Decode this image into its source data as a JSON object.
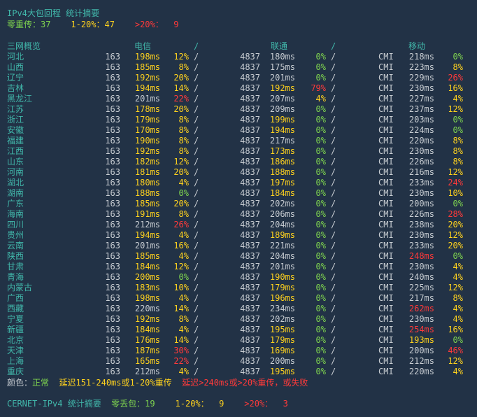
{
  "summary": {
    "title": "IPv4大包回程 统计摘要",
    "zero_label": "零重传：",
    "zero_value": "37",
    "mid_label": "1-20%：",
    "mid_value": "47",
    "high_label": ">20%：",
    "high_value": "9"
  },
  "table": {
    "header": {
      "region": "三网概览",
      "ct": "电信",
      "cu": "联通",
      "cm": "移动",
      "sep": "/"
    },
    "rows": [
      {
        "province": "河北",
        "ct_asn": "163",
        "ct_lat": "198ms",
        "ct_loss": "12%",
        "cu_asn": "4837",
        "cu_lat": "180ms",
        "cu_loss": "0%",
        "cm_asn": "CMI",
        "cm_lat": "218ms",
        "cm_loss": "0%",
        "c": [
          "yel",
          "yel",
          "gry",
          "grn",
          "gry",
          "grn"
        ]
      },
      {
        "province": "山西",
        "ct_asn": "163",
        "ct_lat": "185ms",
        "ct_loss": "8%",
        "cu_asn": "4837",
        "cu_lat": "175ms",
        "cu_loss": "0%",
        "cm_asn": "CMI",
        "cm_lat": "223ms",
        "cm_loss": "8%",
        "c": [
          "yel",
          "yel",
          "gry",
          "grn",
          "gry",
          "yel"
        ]
      },
      {
        "province": "辽宁",
        "ct_asn": "163",
        "ct_lat": "192ms",
        "ct_loss": "20%",
        "cu_asn": "4837",
        "cu_lat": "201ms",
        "cu_loss": "0%",
        "cm_asn": "CMI",
        "cm_lat": "229ms",
        "cm_loss": "26%",
        "c": [
          "yel",
          "yel",
          "gry",
          "grn",
          "gry",
          "red"
        ]
      },
      {
        "province": "吉林",
        "ct_asn": "163",
        "ct_lat": "194ms",
        "ct_loss": "14%",
        "cu_asn": "4837",
        "cu_lat": "192ms",
        "cu_loss": "79%",
        "cm_asn": "CMI",
        "cm_lat": "230ms",
        "cm_loss": "16%",
        "c": [
          "yel",
          "yel",
          "yel",
          "red",
          "gry",
          "yel"
        ]
      },
      {
        "province": "黑龙江",
        "ct_asn": "163",
        "ct_lat": "201ms",
        "ct_loss": "22%",
        "cu_asn": "4837",
        "cu_lat": "207ms",
        "cu_loss": "4%",
        "cm_asn": "CMI",
        "cm_lat": "227ms",
        "cm_loss": "4%",
        "c": [
          "gry",
          "red",
          "gry",
          "yel",
          "gry",
          "yel"
        ]
      },
      {
        "province": "江苏",
        "ct_asn": "163",
        "ct_lat": "178ms",
        "ct_loss": "20%",
        "cu_asn": "4837",
        "cu_lat": "209ms",
        "cu_loss": "0%",
        "cm_asn": "CMI",
        "cm_lat": "237ms",
        "cm_loss": "12%",
        "c": [
          "yel",
          "yel",
          "gry",
          "grn",
          "gry",
          "yel"
        ]
      },
      {
        "province": "浙江",
        "ct_asn": "163",
        "ct_lat": "179ms",
        "ct_loss": "8%",
        "cu_asn": "4837",
        "cu_lat": "199ms",
        "cu_loss": "0%",
        "cm_asn": "CMI",
        "cm_lat": "203ms",
        "cm_loss": "0%",
        "c": [
          "yel",
          "yel",
          "yel",
          "grn",
          "gry",
          "grn"
        ]
      },
      {
        "province": "安徽",
        "ct_asn": "163",
        "ct_lat": "170ms",
        "ct_loss": "8%",
        "cu_asn": "4837",
        "cu_lat": "194ms",
        "cu_loss": "0%",
        "cm_asn": "CMI",
        "cm_lat": "224ms",
        "cm_loss": "0%",
        "c": [
          "yel",
          "yel",
          "yel",
          "grn",
          "gry",
          "grn"
        ]
      },
      {
        "province": "福建",
        "ct_asn": "163",
        "ct_lat": "190ms",
        "ct_loss": "8%",
        "cu_asn": "4837",
        "cu_lat": "217ms",
        "cu_loss": "0%",
        "cm_asn": "CMI",
        "cm_lat": "220ms",
        "cm_loss": "8%",
        "c": [
          "yel",
          "yel",
          "gry",
          "grn",
          "gry",
          "yel"
        ]
      },
      {
        "province": "江西",
        "ct_asn": "163",
        "ct_lat": "192ms",
        "ct_loss": "8%",
        "cu_asn": "4837",
        "cu_lat": "173ms",
        "cu_loss": "0%",
        "cm_asn": "CMI",
        "cm_lat": "230ms",
        "cm_loss": "8%",
        "c": [
          "yel",
          "yel",
          "yel",
          "grn",
          "gry",
          "yel"
        ]
      },
      {
        "province": "山东",
        "ct_asn": "163",
        "ct_lat": "182ms",
        "ct_loss": "12%",
        "cu_asn": "4837",
        "cu_lat": "186ms",
        "cu_loss": "0%",
        "cm_asn": "CMI",
        "cm_lat": "226ms",
        "cm_loss": "8%",
        "c": [
          "yel",
          "yel",
          "yel",
          "grn",
          "gry",
          "yel"
        ]
      },
      {
        "province": "河南",
        "ct_asn": "163",
        "ct_lat": "181ms",
        "ct_loss": "20%",
        "cu_asn": "4837",
        "cu_lat": "188ms",
        "cu_loss": "0%",
        "cm_asn": "CMI",
        "cm_lat": "216ms",
        "cm_loss": "12%",
        "c": [
          "yel",
          "yel",
          "yel",
          "grn",
          "gry",
          "yel"
        ]
      },
      {
        "province": "湖北",
        "ct_asn": "163",
        "ct_lat": "180ms",
        "ct_loss": "4%",
        "cu_asn": "4837",
        "cu_lat": "197ms",
        "cu_loss": "0%",
        "cm_asn": "CMI",
        "cm_lat": "233ms",
        "cm_loss": "24%",
        "c": [
          "yel",
          "yel",
          "yel",
          "grn",
          "gry",
          "red"
        ]
      },
      {
        "province": "湖南",
        "ct_asn": "163",
        "ct_lat": "188ms",
        "ct_loss": "0%",
        "cu_asn": "4837",
        "cu_lat": "184ms",
        "cu_loss": "0%",
        "cm_asn": "CMI",
        "cm_lat": "230ms",
        "cm_loss": "10%",
        "c": [
          "yel",
          "grn",
          "yel",
          "grn",
          "gry",
          "yel"
        ]
      },
      {
        "province": "广东",
        "ct_asn": "163",
        "ct_lat": "185ms",
        "ct_loss": "20%",
        "cu_asn": "4837",
        "cu_lat": "202ms",
        "cu_loss": "0%",
        "cm_asn": "CMI",
        "cm_lat": "200ms",
        "cm_loss": "0%",
        "c": [
          "yel",
          "yel",
          "gry",
          "grn",
          "gry",
          "grn"
        ]
      },
      {
        "province": "海南",
        "ct_asn": "163",
        "ct_lat": "191ms",
        "ct_loss": "8%",
        "cu_asn": "4837",
        "cu_lat": "206ms",
        "cu_loss": "0%",
        "cm_asn": "CMI",
        "cm_lat": "226ms",
        "cm_loss": "28%",
        "c": [
          "yel",
          "yel",
          "gry",
          "grn",
          "gry",
          "red"
        ]
      },
      {
        "province": "四川",
        "ct_asn": "163",
        "ct_lat": "212ms",
        "ct_loss": "26%",
        "cu_asn": "4837",
        "cu_lat": "204ms",
        "cu_loss": "0%",
        "cm_asn": "CMI",
        "cm_lat": "238ms",
        "cm_loss": "20%",
        "c": [
          "gry",
          "red",
          "gry",
          "grn",
          "gry",
          "yel"
        ]
      },
      {
        "province": "贵州",
        "ct_asn": "163",
        "ct_lat": "194ms",
        "ct_loss": "4%",
        "cu_asn": "4837",
        "cu_lat": "189ms",
        "cu_loss": "0%",
        "cm_asn": "CMI",
        "cm_lat": "230ms",
        "cm_loss": "12%",
        "c": [
          "yel",
          "yel",
          "yel",
          "grn",
          "gry",
          "yel"
        ]
      },
      {
        "province": "云南",
        "ct_asn": "163",
        "ct_lat": "201ms",
        "ct_loss": "16%",
        "cu_asn": "4837",
        "cu_lat": "221ms",
        "cu_loss": "0%",
        "cm_asn": "CMI",
        "cm_lat": "233ms",
        "cm_loss": "20%",
        "c": [
          "gry",
          "yel",
          "gry",
          "grn",
          "gry",
          "yel"
        ]
      },
      {
        "province": "陕西",
        "ct_asn": "163",
        "ct_lat": "185ms",
        "ct_loss": "4%",
        "cu_asn": "4837",
        "cu_lat": "204ms",
        "cu_loss": "0%",
        "cm_asn": "CMI",
        "cm_lat": "248ms",
        "cm_loss": "0%",
        "c": [
          "yel",
          "yel",
          "gry",
          "grn",
          "red",
          "grn"
        ]
      },
      {
        "province": "甘肃",
        "ct_asn": "163",
        "ct_lat": "184ms",
        "ct_loss": "12%",
        "cu_asn": "4837",
        "cu_lat": "201ms",
        "cu_loss": "0%",
        "cm_asn": "CMI",
        "cm_lat": "230ms",
        "cm_loss": "4%",
        "c": [
          "yel",
          "yel",
          "gry",
          "grn",
          "gry",
          "yel"
        ]
      },
      {
        "province": "青海",
        "ct_asn": "163",
        "ct_lat": "200ms",
        "ct_loss": "0%",
        "cu_asn": "4837",
        "cu_lat": "190ms",
        "cu_loss": "0%",
        "cm_asn": "CMI",
        "cm_lat": "240ms",
        "cm_loss": "4%",
        "c": [
          "yel",
          "grn",
          "yel",
          "grn",
          "gry",
          "yel"
        ]
      },
      {
        "province": "内蒙古",
        "ct_asn": "163",
        "ct_lat": "183ms",
        "ct_loss": "10%",
        "cu_asn": "4837",
        "cu_lat": "179ms",
        "cu_loss": "0%",
        "cm_asn": "CMI",
        "cm_lat": "225ms",
        "cm_loss": "12%",
        "c": [
          "yel",
          "yel",
          "yel",
          "grn",
          "gry",
          "yel"
        ]
      },
      {
        "province": "广西",
        "ct_asn": "163",
        "ct_lat": "198ms",
        "ct_loss": "4%",
        "cu_asn": "4837",
        "cu_lat": "196ms",
        "cu_loss": "0%",
        "cm_asn": "CMI",
        "cm_lat": "217ms",
        "cm_loss": "8%",
        "c": [
          "yel",
          "yel",
          "yel",
          "grn",
          "gry",
          "yel"
        ]
      },
      {
        "province": "西藏",
        "ct_asn": "163",
        "ct_lat": "220ms",
        "ct_loss": "14%",
        "cu_asn": "4837",
        "cu_lat": "234ms",
        "cu_loss": "0%",
        "cm_asn": "CMI",
        "cm_lat": "262ms",
        "cm_loss": "4%",
        "c": [
          "gry",
          "yel",
          "gry",
          "grn",
          "red",
          "yel"
        ]
      },
      {
        "province": "宁夏",
        "ct_asn": "163",
        "ct_lat": "192ms",
        "ct_loss": "8%",
        "cu_asn": "4837",
        "cu_lat": "202ms",
        "cu_loss": "0%",
        "cm_asn": "CMI",
        "cm_lat": "230ms",
        "cm_loss": "4%",
        "c": [
          "yel",
          "yel",
          "gry",
          "grn",
          "gry",
          "yel"
        ]
      },
      {
        "province": "新疆",
        "ct_asn": "163",
        "ct_lat": "184ms",
        "ct_loss": "4%",
        "cu_asn": "4837",
        "cu_lat": "195ms",
        "cu_loss": "0%",
        "cm_asn": "CMI",
        "cm_lat": "254ms",
        "cm_loss": "16%",
        "c": [
          "yel",
          "yel",
          "yel",
          "grn",
          "red",
          "yel"
        ]
      },
      {
        "province": "北京",
        "ct_asn": "163",
        "ct_lat": "176ms",
        "ct_loss": "14%",
        "cu_asn": "4837",
        "cu_lat": "179ms",
        "cu_loss": "0%",
        "cm_asn": "CMI",
        "cm_lat": "193ms",
        "cm_loss": "0%",
        "c": [
          "yel",
          "yel",
          "yel",
          "grn",
          "yel",
          "grn"
        ]
      },
      {
        "province": "天津",
        "ct_asn": "163",
        "ct_lat": "187ms",
        "ct_loss": "30%",
        "cu_asn": "4837",
        "cu_lat": "169ms",
        "cu_loss": "0%",
        "cm_asn": "CMI",
        "cm_lat": "200ms",
        "cm_loss": "46%",
        "c": [
          "yel",
          "red",
          "yel",
          "grn",
          "gry",
          "red"
        ]
      },
      {
        "province": "上海",
        "ct_asn": "163",
        "ct_lat": "165ms",
        "ct_loss": "22%",
        "cu_asn": "4837",
        "cu_lat": "200ms",
        "cu_loss": "0%",
        "cm_asn": "CMI",
        "cm_lat": "212ms",
        "cm_loss": "12%",
        "c": [
          "yel",
          "red",
          "gry",
          "grn",
          "gry",
          "yel"
        ]
      },
      {
        "province": "重庆",
        "ct_asn": "163",
        "ct_lat": "212ms",
        "ct_loss": "4%",
        "cu_asn": "4837",
        "cu_lat": "195ms",
        "cu_loss": "0%",
        "cm_asn": "CMI",
        "cm_lat": "220ms",
        "cm_loss": "4%",
        "c": [
          "gry",
          "yel",
          "yel",
          "grn",
          "gry",
          "yel"
        ]
      }
    ]
  },
  "legend": {
    "label": "颜色：",
    "normal": "正常",
    "warn": "延迟151-240ms或1-20%重传",
    "bad": "延迟>240ms或>20%重传，或失败"
  },
  "cernet": {
    "title": "CERNET-IPv4 统计摘要",
    "zero_label": "零丢包：",
    "zero_value": "19",
    "mid_label": "1-20%：",
    "mid_value": "9",
    "high_label": ">20%：",
    "high_value": "3"
  }
}
